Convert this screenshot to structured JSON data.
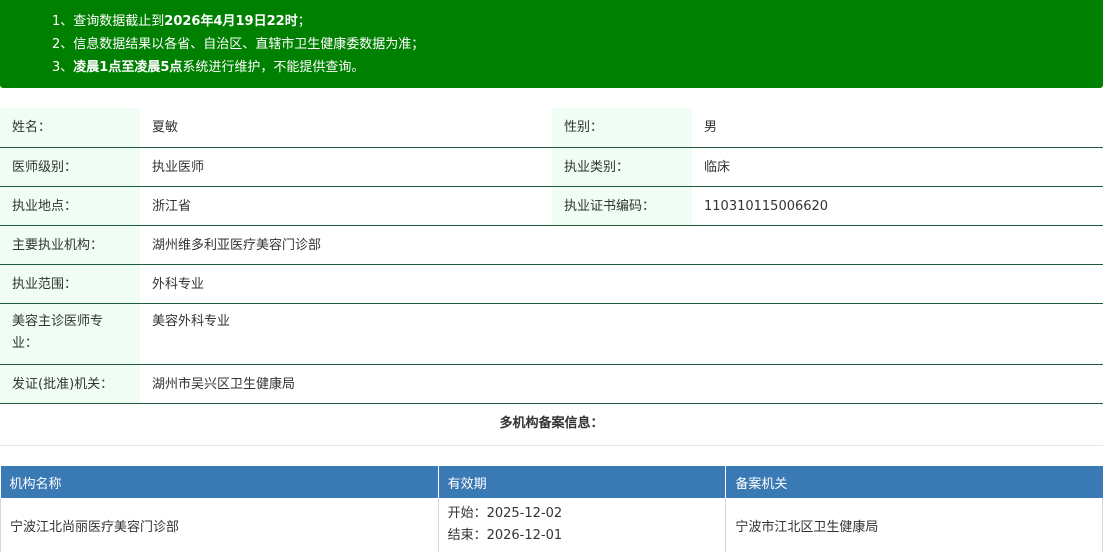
{
  "notice": {
    "line1_prefix": "1、查询数据截止到",
    "line1_bold": "2026年4月19日22时",
    "line1_suffix": "；",
    "line2": "2、信息数据结果以各省、自治区、直辖市卫生健康委数据为准；",
    "line3_prefix": "3、",
    "line3_bold": "凌晨1点至凌晨5点",
    "line3_suffix": "系统进行维护，不能提供查询。"
  },
  "doctor": {
    "name_label": "姓名：",
    "name": "夏敏",
    "gender_label": "性别：",
    "gender": "男",
    "level_label": "医师级别：",
    "level": "执业医师",
    "category_label": "执业类别：",
    "category": "临床",
    "location_label": "执业地点：",
    "location": "浙江省",
    "cert_label": "执业证书编码：",
    "cert": "110310115006620",
    "org_label": "主要执业机构：",
    "org": "湖州维多利亚医疗美容门诊部",
    "scope_label": "执业范围：",
    "scope": "外科专业",
    "cosmetic_label": "美容主诊医师专业：",
    "cosmetic": "美容外科专业",
    "issuer_label": "发证(批准)机关：",
    "issuer": "湖州市吴兴区卫生健康局"
  },
  "multi_org": {
    "title": "多机构备案信息：",
    "headers": [
      "机构名称",
      "有效期",
      "备案机关"
    ],
    "rows": [
      {
        "name": "宁波江北尚丽医疗美容门诊部",
        "start": "开始：2025-12-02",
        "end": "结束：2026-12-01",
        "authority": "宁波市江北区卫生健康局"
      }
    ]
  },
  "colors": {
    "notice_bg": "#008000",
    "label_bg": "#effdf5",
    "header_bg": "#3979b4",
    "row_border": "#1f5c3a"
  }
}
